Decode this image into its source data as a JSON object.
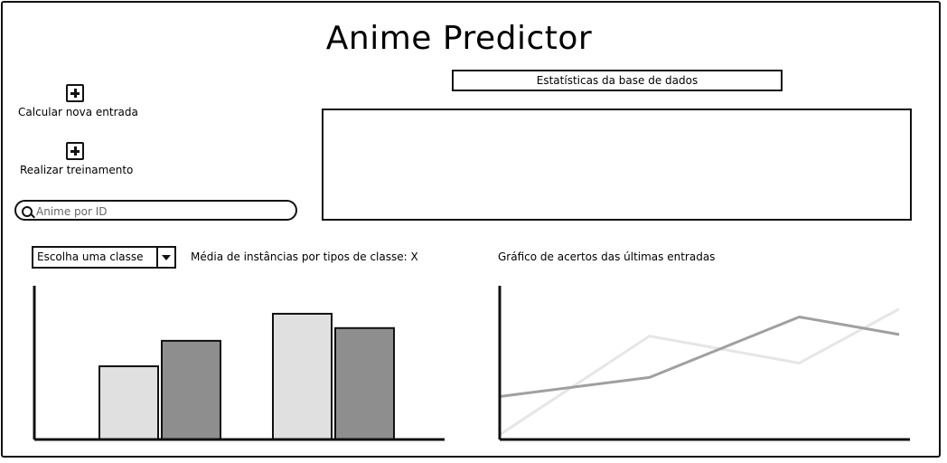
{
  "header": {
    "title": "Anime Predictor"
  },
  "actions": {
    "new_entry_label": "Calcular nova entrada",
    "train_label": "Realizar treinamento"
  },
  "search": {
    "placeholder": "Anime por ID",
    "value": ""
  },
  "stats": {
    "button_label": "Estatísticas da base de dados"
  },
  "class_select": {
    "selected": "Escolha uma classe"
  },
  "bar_section": {
    "caption": "Média de instâncias por tipos de classe: X"
  },
  "line_section": {
    "caption": "Gráfico de acertos das últimas entradas"
  },
  "chart_data": [
    {
      "type": "bar",
      "categories": [
        "",
        ""
      ],
      "series": [
        {
          "values": [
            0.46,
            0.79
          ],
          "color": "#e0e0e0"
        },
        {
          "values": [
            0.62,
            0.7
          ],
          "color": "#8e8e8e"
        }
      ],
      "ylim": [
        0,
        1
      ],
      "grid": false
    },
    {
      "type": "line",
      "x": [
        0,
        1,
        2,
        3,
        4
      ],
      "series": [
        {
          "values": [
            0.27,
            0.39,
            0.77,
            0.66
          ],
          "x": [
            0,
            1.5,
            3,
            4
          ],
          "color": "#a0a0a0"
        },
        {
          "values": [
            0.03,
            0.65,
            0.48,
            0.82
          ],
          "x": [
            0,
            1.5,
            3,
            4
          ],
          "color": "#e6e6e6"
        }
      ],
      "ylim": [
        0,
        1
      ],
      "grid": false
    }
  ]
}
